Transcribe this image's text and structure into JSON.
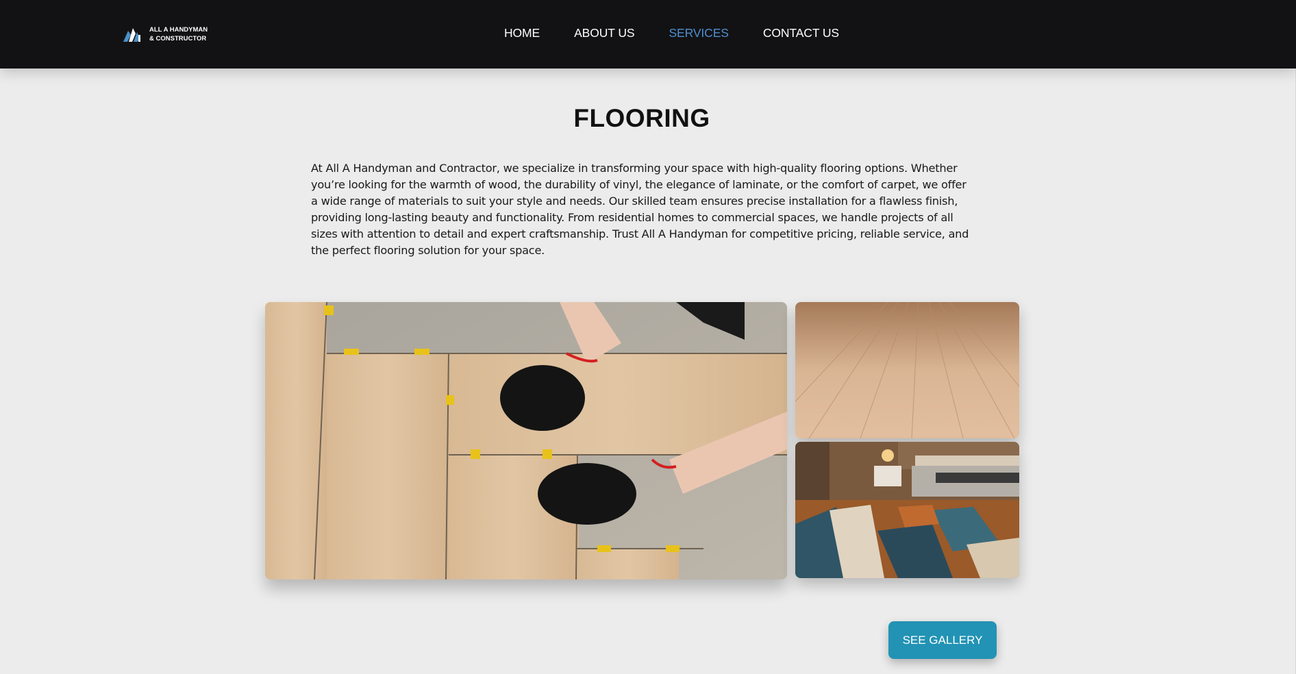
{
  "header": {
    "logo_text": "ALL A HANDYMAN & CONSTRUCTOR",
    "logo_icon": "building-logo-icon",
    "nav": [
      {
        "label": "HOME"
      },
      {
        "label": "ABOUT US"
      },
      {
        "label": "SERVICES",
        "active": true
      },
      {
        "label": "CONTACT US"
      }
    ]
  },
  "main": {
    "title": "FLOORING",
    "description": "At All A Handyman and Contractor, we specialize in transforming your space with high-quality flooring options. Whether you’re looking for the warmth of wood, the durability of vinyl, the elegance of laminate, or the comfort of carpet, we offer a wide range of materials to suit your style and needs. Our skilled team ensures precise installation for a flawless finish, providing long-lasting beauty and functionality. From residential homes to commercial spaces, we handle projects of all sizes with attention to detail and expert craftsmanship. Trust All A Handyman for competitive pricing, reliable service, and the perfect flooring solution for your space.",
    "gallery_button": "SEE GALLERY"
  },
  "colors": {
    "header_bg": "#121214",
    "active_nav": "#4f8fcf",
    "page_bg": "#ececec",
    "button_bg": "#2293b4"
  }
}
